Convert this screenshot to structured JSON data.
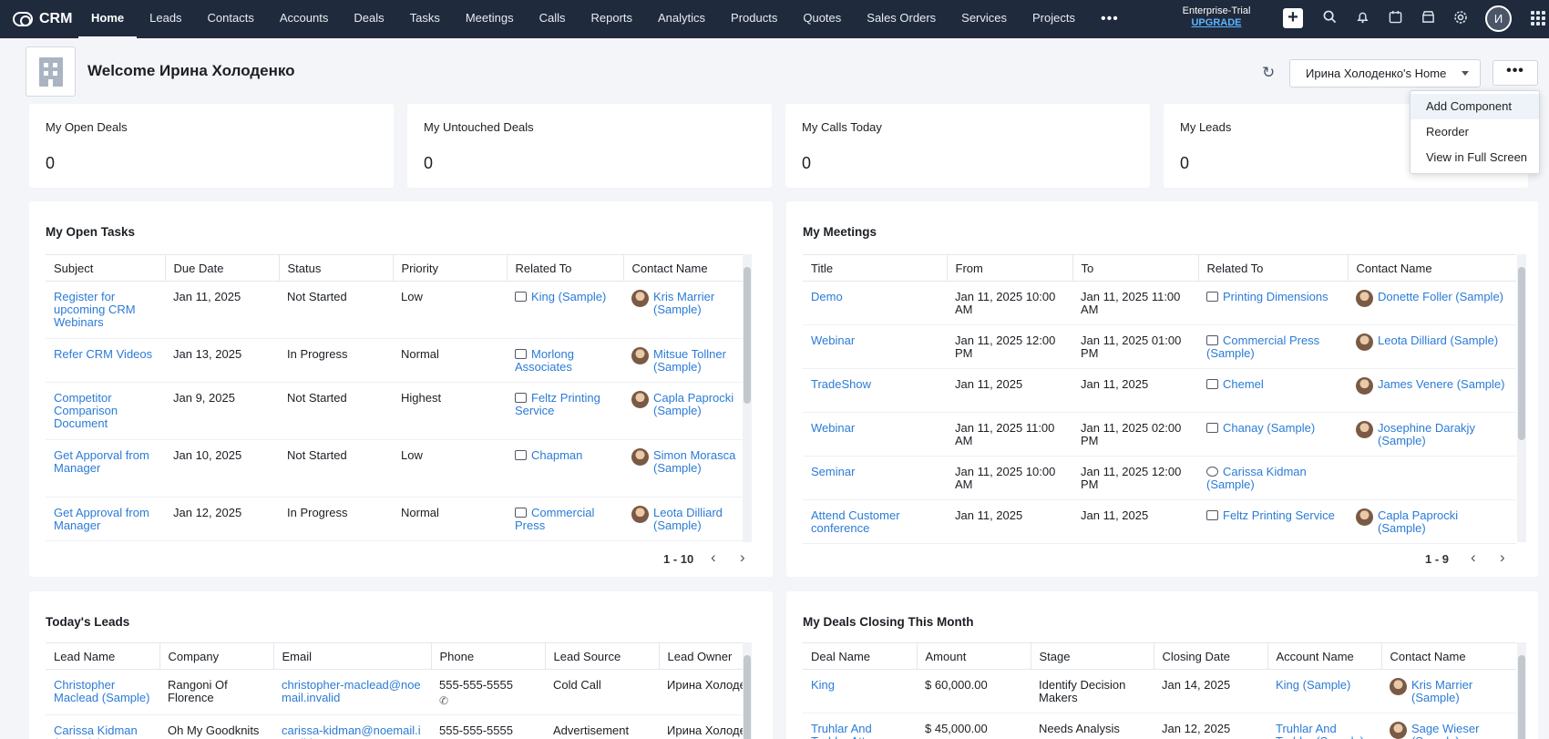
{
  "app": {
    "logo": "CRM"
  },
  "nav": {
    "items": [
      "Home",
      "Leads",
      "Contacts",
      "Accounts",
      "Deals",
      "Tasks",
      "Meetings",
      "Calls",
      "Reports",
      "Analytics",
      "Products",
      "Quotes",
      "Sales Orders",
      "Services",
      "Projects"
    ],
    "more": "•••"
  },
  "topbar": {
    "trial": "Enterprise-Trial",
    "upgrade": "UPGRADE",
    "avatar": "И",
    "icons": [
      "plus-icon",
      "search-icon",
      "bell-icon",
      "calendar-check-icon",
      "marketplace-icon",
      "gear-icon",
      "apps-grid-icon"
    ]
  },
  "header": {
    "welcome": "Welcome Ирина Холоденко",
    "home_select": "Ирина Холоденко's Home",
    "more": "•••"
  },
  "dropdown": {
    "items": [
      "Add Component",
      "Reorder",
      "View in Full Screen"
    ]
  },
  "kpis": [
    {
      "label": "My Open Deals",
      "value": "0"
    },
    {
      "label": "My Untouched Deals",
      "value": "0"
    },
    {
      "label": "My Calls Today",
      "value": "0"
    },
    {
      "label": "My Leads",
      "value": "0"
    }
  ],
  "tasks": {
    "title": "My Open Tasks",
    "columns": [
      "Subject",
      "Due Date",
      "Status",
      "Priority",
      "Related To",
      "Contact Name"
    ],
    "rows": [
      {
        "subject": "Register for upcoming CRM Webinars",
        "due": "Jan 11, 2025",
        "status": "Not Started",
        "priority": "Low",
        "related": "King (Sample)",
        "contact": "Kris Marrier (Sample)"
      },
      {
        "subject": "Refer CRM Videos",
        "due": "Jan 13, 2025",
        "status": "In Progress",
        "priority": "Normal",
        "related": "Morlong Associates",
        "contact": "Mitsue Tollner (Sample)"
      },
      {
        "subject": "Competitor Comparison Document",
        "due": "Jan 9, 2025",
        "status": "Not Started",
        "priority": "Highest",
        "related": "Feltz Printing Service",
        "contact": "Capla Paprocki (Sample)"
      },
      {
        "subject": "Get Apporval from Manager",
        "due": "Jan 10, 2025",
        "status": "Not Started",
        "priority": "Low",
        "related": "Chapman",
        "contact": "Simon Morasca (Sample)"
      },
      {
        "subject": "Get Approval from Manager",
        "due": "Jan 12, 2025",
        "status": "In Progress",
        "priority": "Normal",
        "related": "Commercial Press",
        "contact": "Leota Dilliard (Sample)"
      }
    ],
    "pager": "1 - 10"
  },
  "meetings": {
    "title": "My Meetings",
    "columns": [
      "Title",
      "From",
      "To",
      "Related To",
      "Contact Name"
    ],
    "rows": [
      {
        "title": "Demo",
        "from": "Jan 11, 2025 10:00 AM",
        "to": "Jan 11, 2025 11:00 AM",
        "related": "Printing Dimensions",
        "contact": "Donette Foller (Sample)"
      },
      {
        "title": "Webinar",
        "from": "Jan 11, 2025 12:00 PM",
        "to": "Jan 11, 2025 01:00 PM",
        "related": "Commercial Press (Sample)",
        "contact": "Leota Dilliard (Sample)"
      },
      {
        "title": "TradeShow",
        "from": "Jan 11, 2025",
        "to": "Jan 11, 2025",
        "related": "Chemel",
        "contact": "James Venere (Sample)"
      },
      {
        "title": "Webinar",
        "from": "Jan 11, 2025 11:00 AM",
        "to": "Jan 11, 2025 02:00 PM",
        "related": "Chanay (Sample)",
        "contact": "Josephine Darakjy (Sample)"
      },
      {
        "title": "Seminar",
        "from": "Jan 11, 2025 10:00 AM",
        "to": "Jan 11, 2025 12:00 PM",
        "related": "Carissa Kidman (Sample)",
        "contact": ""
      },
      {
        "title": "Attend Customer conference",
        "from": "Jan 11, 2025",
        "to": "Jan 11, 2025",
        "related": "Feltz Printing Service",
        "contact": "Capla Paprocki (Sample)"
      }
    ],
    "pager": "1 - 9"
  },
  "leads": {
    "title": "Today's Leads",
    "columns": [
      "Lead Name",
      "Company",
      "Email",
      "Phone",
      "Lead Source",
      "Lead Owner"
    ],
    "rows": [
      {
        "name": "Christopher Maclead (Sample)",
        "company": "Rangoni Of Florence",
        "email": "christopher-maclead@noemail.invalid",
        "phone": "555-555-5555",
        "source": "Cold Call",
        "owner": "Ирина Холоденко"
      },
      {
        "name": "Carissa Kidman (Sample)",
        "company": "Oh My Goodknits Inc",
        "email": "carissa-kidman@noemail.invalid",
        "phone": "555-555-5555",
        "source": "Advertisement",
        "owner": "Ирина Холоденко"
      }
    ]
  },
  "deals": {
    "title": "My Deals Closing This Month",
    "columns": [
      "Deal Name",
      "Amount",
      "Stage",
      "Closing Date",
      "Account Name",
      "Contact Name"
    ],
    "rows": [
      {
        "name": "King",
        "amount": "$ 60,000.00",
        "stage": "Identify Decision Makers",
        "closing": "Jan 14, 2025",
        "account": "King (Sample)",
        "contact": "Kris Marrier (Sample)"
      },
      {
        "name": "Truhlar And Truhlar Attys",
        "amount": "$ 45,000.00",
        "stage": "Needs Analysis",
        "closing": "Jan 12, 2025",
        "account": "Truhlar And Truhlar (Sample)",
        "contact": "Sage Wieser (Sample)"
      }
    ]
  }
}
